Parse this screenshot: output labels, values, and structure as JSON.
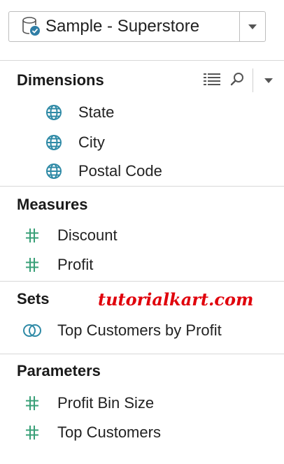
{
  "data_source": {
    "label": "Sample - Superstore",
    "icon": "database-check-icon"
  },
  "dimensions": {
    "title": "Dimensions",
    "toolbar_icons": [
      "list-view-icon",
      "search-icon",
      "menu-dropdown-icon"
    ],
    "items": [
      {
        "label": "State",
        "icon": "globe-icon"
      },
      {
        "label": "City",
        "icon": "globe-icon"
      },
      {
        "label": "Postal Code",
        "icon": "globe-icon"
      }
    ]
  },
  "measures": {
    "title": "Measures",
    "items": [
      {
        "label": "Discount",
        "icon": "hash-icon"
      },
      {
        "label": "Profit",
        "icon": "hash-icon"
      }
    ]
  },
  "sets": {
    "title": "Sets",
    "items": [
      {
        "label": "Top Customers by Profit",
        "icon": "set-icon"
      }
    ]
  },
  "parameters": {
    "title": "Parameters",
    "items": [
      {
        "label": "Profit Bin Size",
        "icon": "hash-icon"
      },
      {
        "label": "Top Customers",
        "icon": "hash-icon"
      }
    ]
  },
  "watermark": "tutorialkart.com",
  "colors": {
    "globe": "#2f8aa6",
    "hash": "#3aa078",
    "set": "#2f8aa6",
    "watermark": "#e0000b"
  }
}
